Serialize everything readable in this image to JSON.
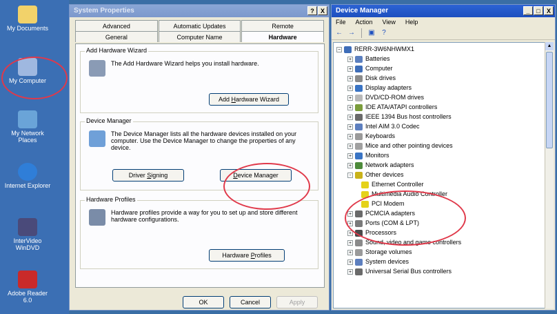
{
  "desktop": {
    "icons": [
      {
        "label": "My Documents"
      },
      {
        "label": "My Computer"
      },
      {
        "label": "My Network Places"
      },
      {
        "label": "Internet Explorer"
      },
      {
        "label": "InterVideo WinDVD"
      },
      {
        "label": "Adobe Reader 6.0"
      }
    ]
  },
  "sysprops": {
    "title": "System Properties",
    "controls": [
      "?",
      "X"
    ],
    "tabs_top": [
      "Advanced",
      "Automatic Updates",
      "Remote"
    ],
    "tabs_bottom": [
      "General",
      "Computer Name",
      "Hardware"
    ],
    "active_tab": "Hardware",
    "add_wizard": {
      "group_title": "Add Hardware Wizard",
      "text": "The Add Hardware Wizard helps you install hardware.",
      "button_pre": "Add ",
      "button_key": "H",
      "button_post": "ardware Wizard"
    },
    "device_manager": {
      "group_title": "Device Manager",
      "text": "The Device Manager lists all the hardware devices installed on your computer. Use the Device Manager to change the properties of any device.",
      "signing_pre": "Driver ",
      "signing_key": "S",
      "signing_post": "igning",
      "dm_pre": "",
      "dm_key": "D",
      "dm_post": "evice Manager"
    },
    "profiles": {
      "group_title": "Hardware Profiles",
      "text": "Hardware profiles provide a way for you to set up and store different hardware configurations.",
      "button_pre": "Hardware ",
      "button_key": "P",
      "button_post": "rofiles"
    },
    "ok": "OK",
    "cancel": "Cancel",
    "apply": "Apply"
  },
  "devmgr": {
    "title": "Device Manager",
    "controls": [
      "_",
      "□",
      "X"
    ],
    "menu": [
      "File",
      "Action",
      "View",
      "Help"
    ],
    "toolbar_icons": [
      "back-arrow-icon",
      "forward-arrow-icon",
      "properties-icon",
      "help-icon"
    ],
    "root": "RERR-3W6NHWMX1",
    "nodes": [
      {
        "label": "Batteries",
        "sign": "+",
        "color": "#5b7fbf"
      },
      {
        "label": "Computer",
        "sign": "+",
        "color": "#3e6db8"
      },
      {
        "label": "Disk drives",
        "sign": "+",
        "color": "#8a8a8a"
      },
      {
        "label": "Display adapters",
        "sign": "+",
        "color": "#3a74c4"
      },
      {
        "label": "DVD/CD-ROM drives",
        "sign": "+",
        "color": "#b8b8b8"
      },
      {
        "label": "IDE ATA/ATAPI controllers",
        "sign": "+",
        "color": "#7b9d3c"
      },
      {
        "label": "IEEE 1394 Bus host controllers",
        "sign": "+",
        "color": "#6a6a6a"
      },
      {
        "label": "Intel AIM 3.0 Codec",
        "sign": "+",
        "color": "#5d7fbf"
      },
      {
        "label": "Keyboards",
        "sign": "+",
        "color": "#9a9a9a"
      },
      {
        "label": "Mice and other pointing devices",
        "sign": "+",
        "color": "#a0a0a0"
      },
      {
        "label": "Monitors",
        "sign": "+",
        "color": "#3a74c4"
      },
      {
        "label": "Network adapters",
        "sign": "+",
        "color": "#4d8a3a"
      },
      {
        "label": "Other devices",
        "sign": "-",
        "color": "#c9b21a"
      },
      {
        "label": "Ethernet Controller",
        "sign": "",
        "color": "#e5d21a",
        "child": true
      },
      {
        "label": "Multimedia Audio Controller",
        "sign": "",
        "color": "#e5d21a",
        "child": true
      },
      {
        "label": "PCI Modem",
        "sign": "",
        "color": "#e5d21a",
        "child": true
      },
      {
        "label": "PCMCIA adapters",
        "sign": "+",
        "color": "#6a6a6a"
      },
      {
        "label": "Ports (COM & LPT)",
        "sign": "+",
        "color": "#7a7a7a"
      },
      {
        "label": "Processors",
        "sign": "+",
        "color": "#4a4a4a"
      },
      {
        "label": "Sound, video and game controllers",
        "sign": "+",
        "color": "#8a8a8a"
      },
      {
        "label": "Storage volumes",
        "sign": "+",
        "color": "#9a9a9a"
      },
      {
        "label": "System devices",
        "sign": "+",
        "color": "#5d7fbf"
      },
      {
        "label": "Universal Serial Bus controllers",
        "sign": "+",
        "color": "#6a6a6a"
      }
    ]
  },
  "colors": {
    "desktop_bg": "#3a6ea5",
    "titlebar": "#1d4fbf",
    "callout": "#e0394a"
  }
}
